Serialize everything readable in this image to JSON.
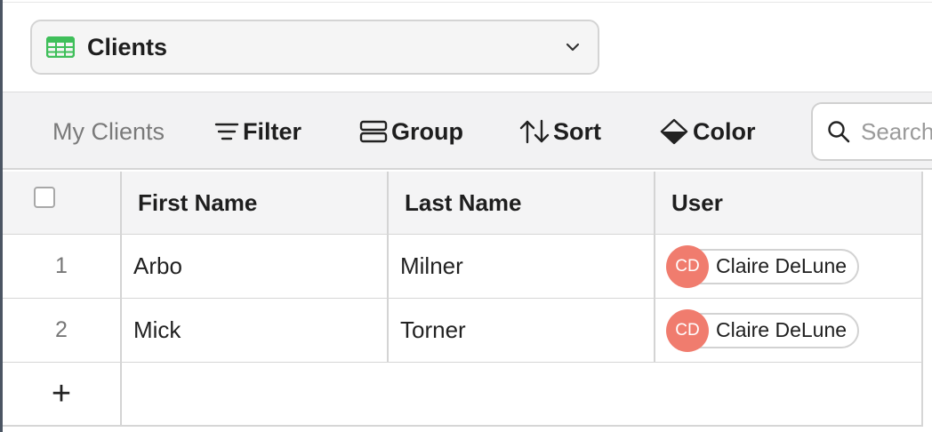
{
  "table_selector": {
    "name": "Clients"
  },
  "toolbar": {
    "view_name": "My Clients",
    "filter_label": "Filter",
    "group_label": "Group",
    "sort_label": "Sort",
    "color_label": "Color",
    "search_placeholder": "Search"
  },
  "grid": {
    "columns": [
      "First Name",
      "Last Name",
      "User"
    ],
    "rows": [
      {
        "index": "1",
        "first_name": "Arbo",
        "last_name": "Milner",
        "user": {
          "initials": "CD",
          "name": "Claire DeLune"
        }
      },
      {
        "index": "2",
        "first_name": "Mick",
        "last_name": "Torner",
        "user": {
          "initials": "CD",
          "name": "Claire DeLune"
        }
      }
    ],
    "add_row_label": "+"
  },
  "colors": {
    "avatar": "#f07c6e",
    "table_icon": "#3fbf5a",
    "toolbar_bg": "#f2f2f3"
  }
}
